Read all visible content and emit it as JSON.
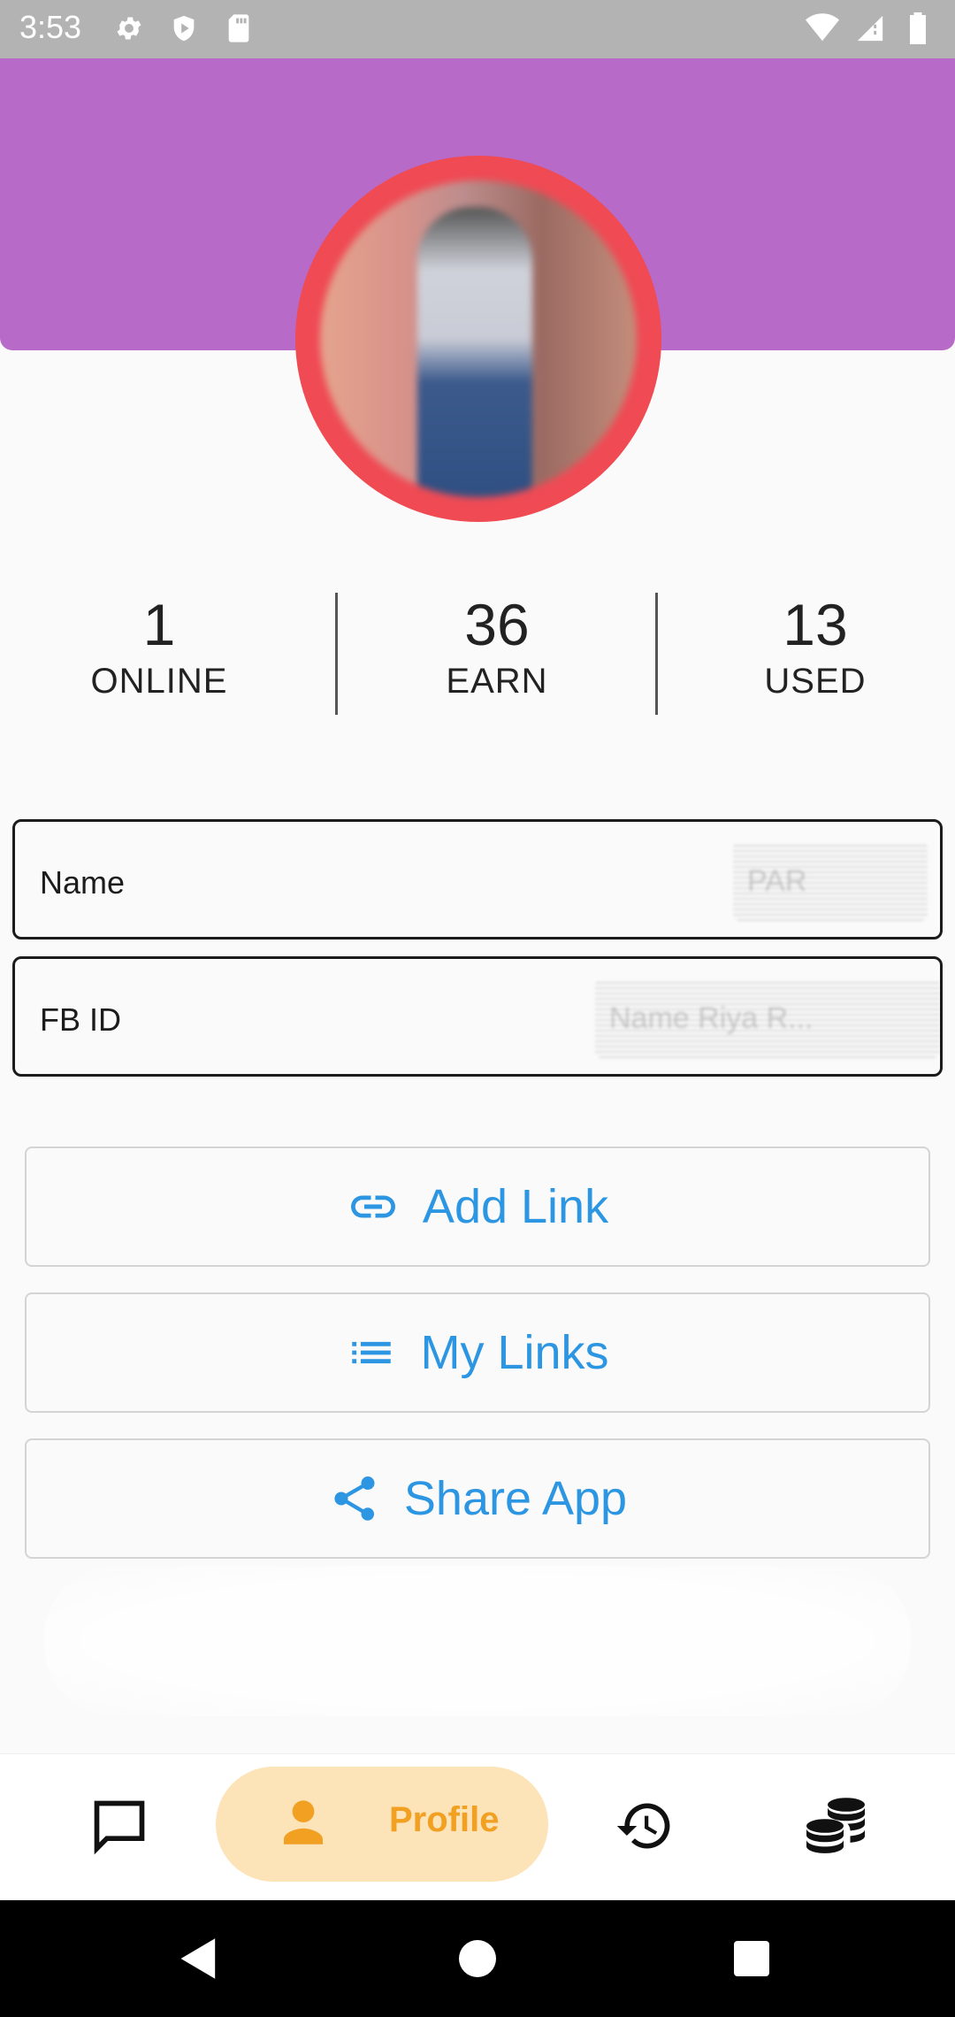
{
  "status_bar": {
    "time": "3:53",
    "left_icons": [
      "gear-icon",
      "shield-play-icon",
      "sd-card-icon"
    ],
    "right_icons": [
      "wifi-icon",
      "signal-icon",
      "battery-icon"
    ]
  },
  "header": {
    "banner_color": "#b86ac8",
    "avatar_ring_color": "#f04c55"
  },
  "stats": [
    {
      "value": "1",
      "label": "ONLINE"
    },
    {
      "value": "36",
      "label": "EARN"
    },
    {
      "value": "13",
      "label": "USED"
    }
  ],
  "fields": {
    "name": {
      "label": "Name",
      "value": "PAR"
    },
    "fb_id": {
      "label": "FB ID",
      "value": "Name Riya R..."
    }
  },
  "actions": {
    "add_link": {
      "label": "Add Link",
      "icon": "link-icon"
    },
    "my_links": {
      "label": "My Links",
      "icon": "list-icon"
    },
    "share_app": {
      "label": "Share App",
      "icon": "share-icon"
    }
  },
  "bottom_nav": {
    "items": [
      {
        "icon": "chat-icon"
      },
      {
        "icon": "person-icon",
        "label": "Profile",
        "active": true
      },
      {
        "icon": "history-icon"
      },
      {
        "icon": "coins-icon"
      }
    ],
    "active_color": "#f2a022",
    "active_bg": "#fde3b8"
  },
  "accent_color": "#2c96e3"
}
